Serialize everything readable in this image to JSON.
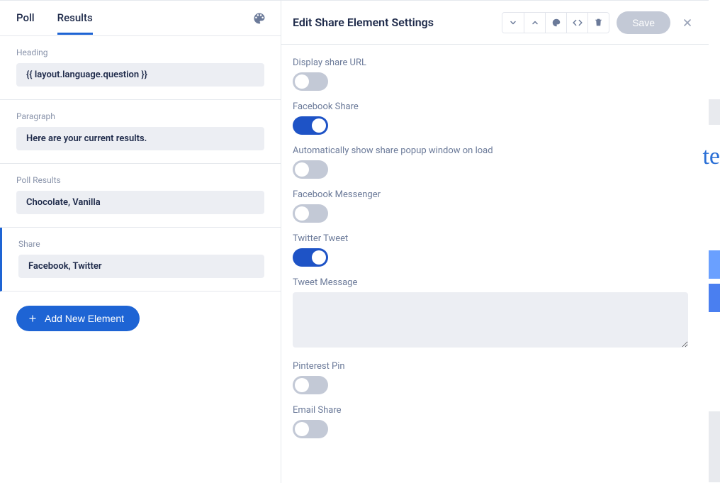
{
  "tabs": {
    "poll": "Poll",
    "results": "Results"
  },
  "sections": {
    "heading": {
      "label": "Heading",
      "value": "{{ layout.language.question }}"
    },
    "paragraph": {
      "label": "Paragraph",
      "value": "Here are your current results."
    },
    "poll": {
      "label": "Poll Results",
      "value": "Chocolate, Vanilla"
    },
    "share": {
      "label": "Share",
      "value": "Facebook, Twitter"
    }
  },
  "addButton": "Add New Element",
  "panel": {
    "title": "Edit Share Element Settings",
    "save": "Save",
    "settings": {
      "displayUrl": {
        "label": "Display share URL",
        "on": false
      },
      "fbShare": {
        "label": "Facebook Share",
        "on": true
      },
      "autoPopup": {
        "label": "Automatically show share popup window on load",
        "on": false
      },
      "fbMessenger": {
        "label": "Facebook Messenger",
        "on": false
      },
      "twitter": {
        "label": "Twitter Tweet",
        "on": true
      },
      "tweetMsg": {
        "label": "Tweet Message",
        "value": ""
      },
      "pinterest": {
        "label": "Pinterest Pin",
        "on": false
      },
      "email": {
        "label": "Email Share",
        "on": false
      }
    }
  }
}
